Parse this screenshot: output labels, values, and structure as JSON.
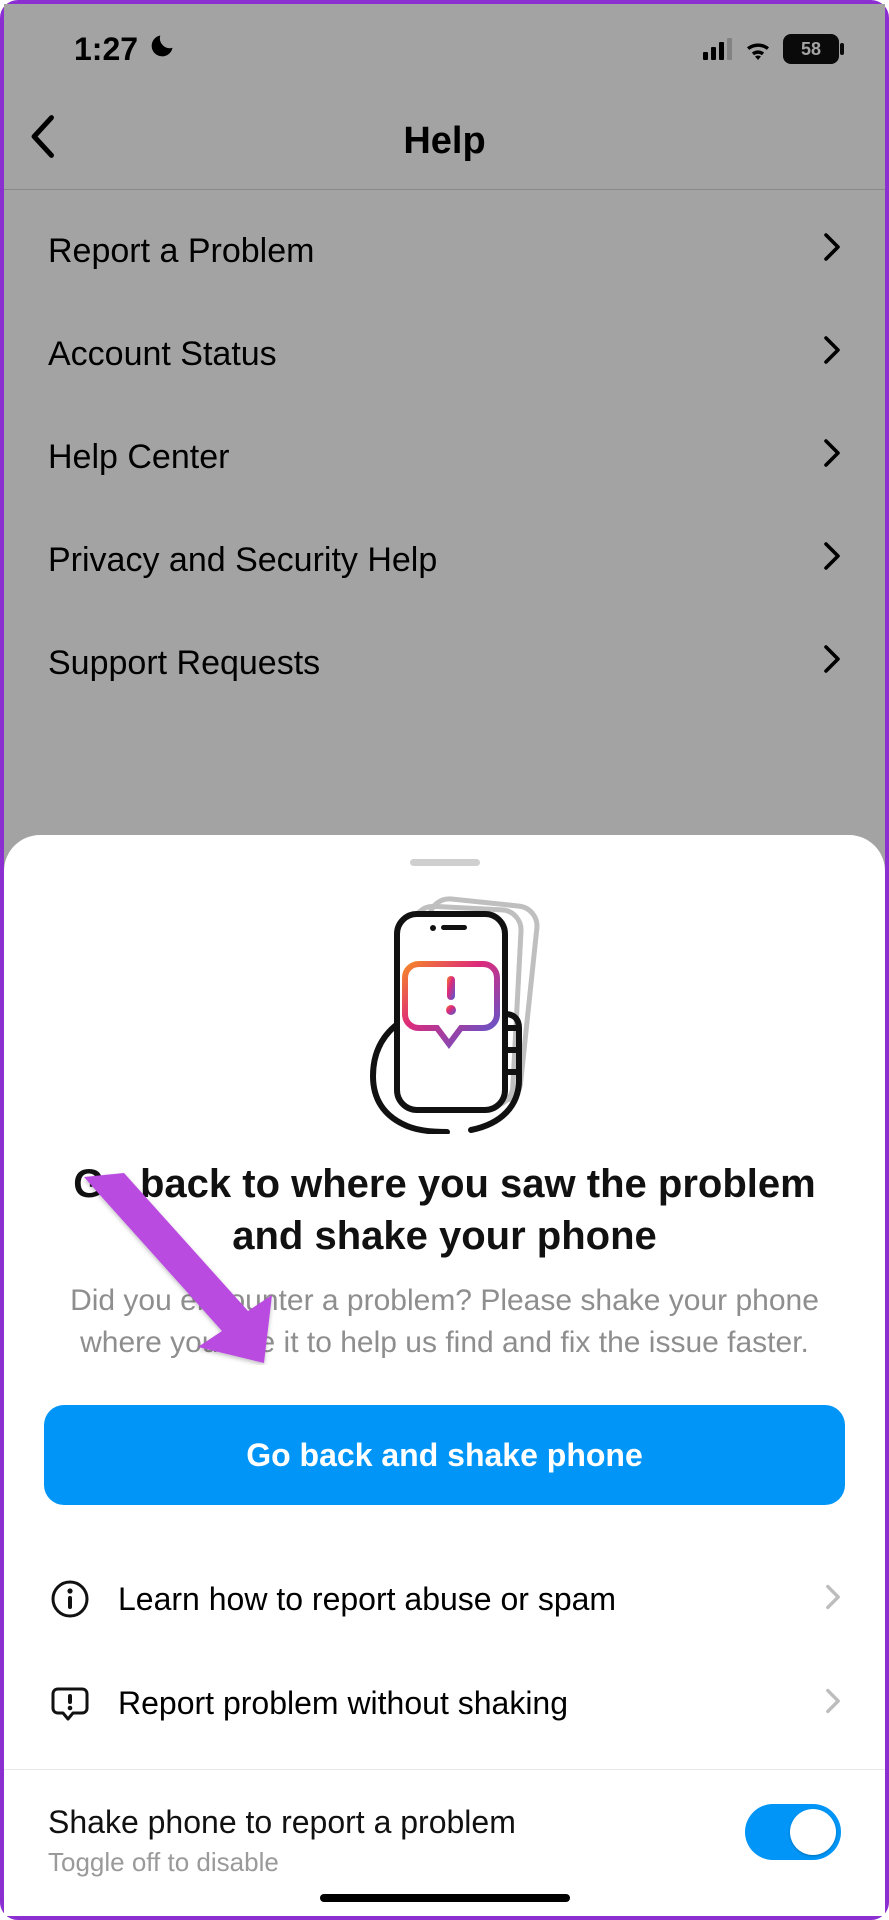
{
  "status": {
    "time": "1:27",
    "battery": "58"
  },
  "nav": {
    "title": "Help"
  },
  "menu": {
    "items": [
      {
        "label": "Report a Problem"
      },
      {
        "label": "Account Status"
      },
      {
        "label": "Help Center"
      },
      {
        "label": "Privacy and Security Help"
      },
      {
        "label": "Support Requests"
      }
    ]
  },
  "sheet": {
    "title": "Go back to where you saw the problem and shake your phone",
    "subtitle": "Did you encounter a problem? Please shake your phone where you see it to help us find and fix the issue faster.",
    "cta": "Go back and shake phone",
    "items": [
      {
        "label": "Learn how to report abuse or spam"
      },
      {
        "label": "Report problem without shaking"
      }
    ],
    "toggle": {
      "title": "Shake phone to report a problem",
      "subtitle": "Toggle off to disable",
      "on": true
    }
  }
}
